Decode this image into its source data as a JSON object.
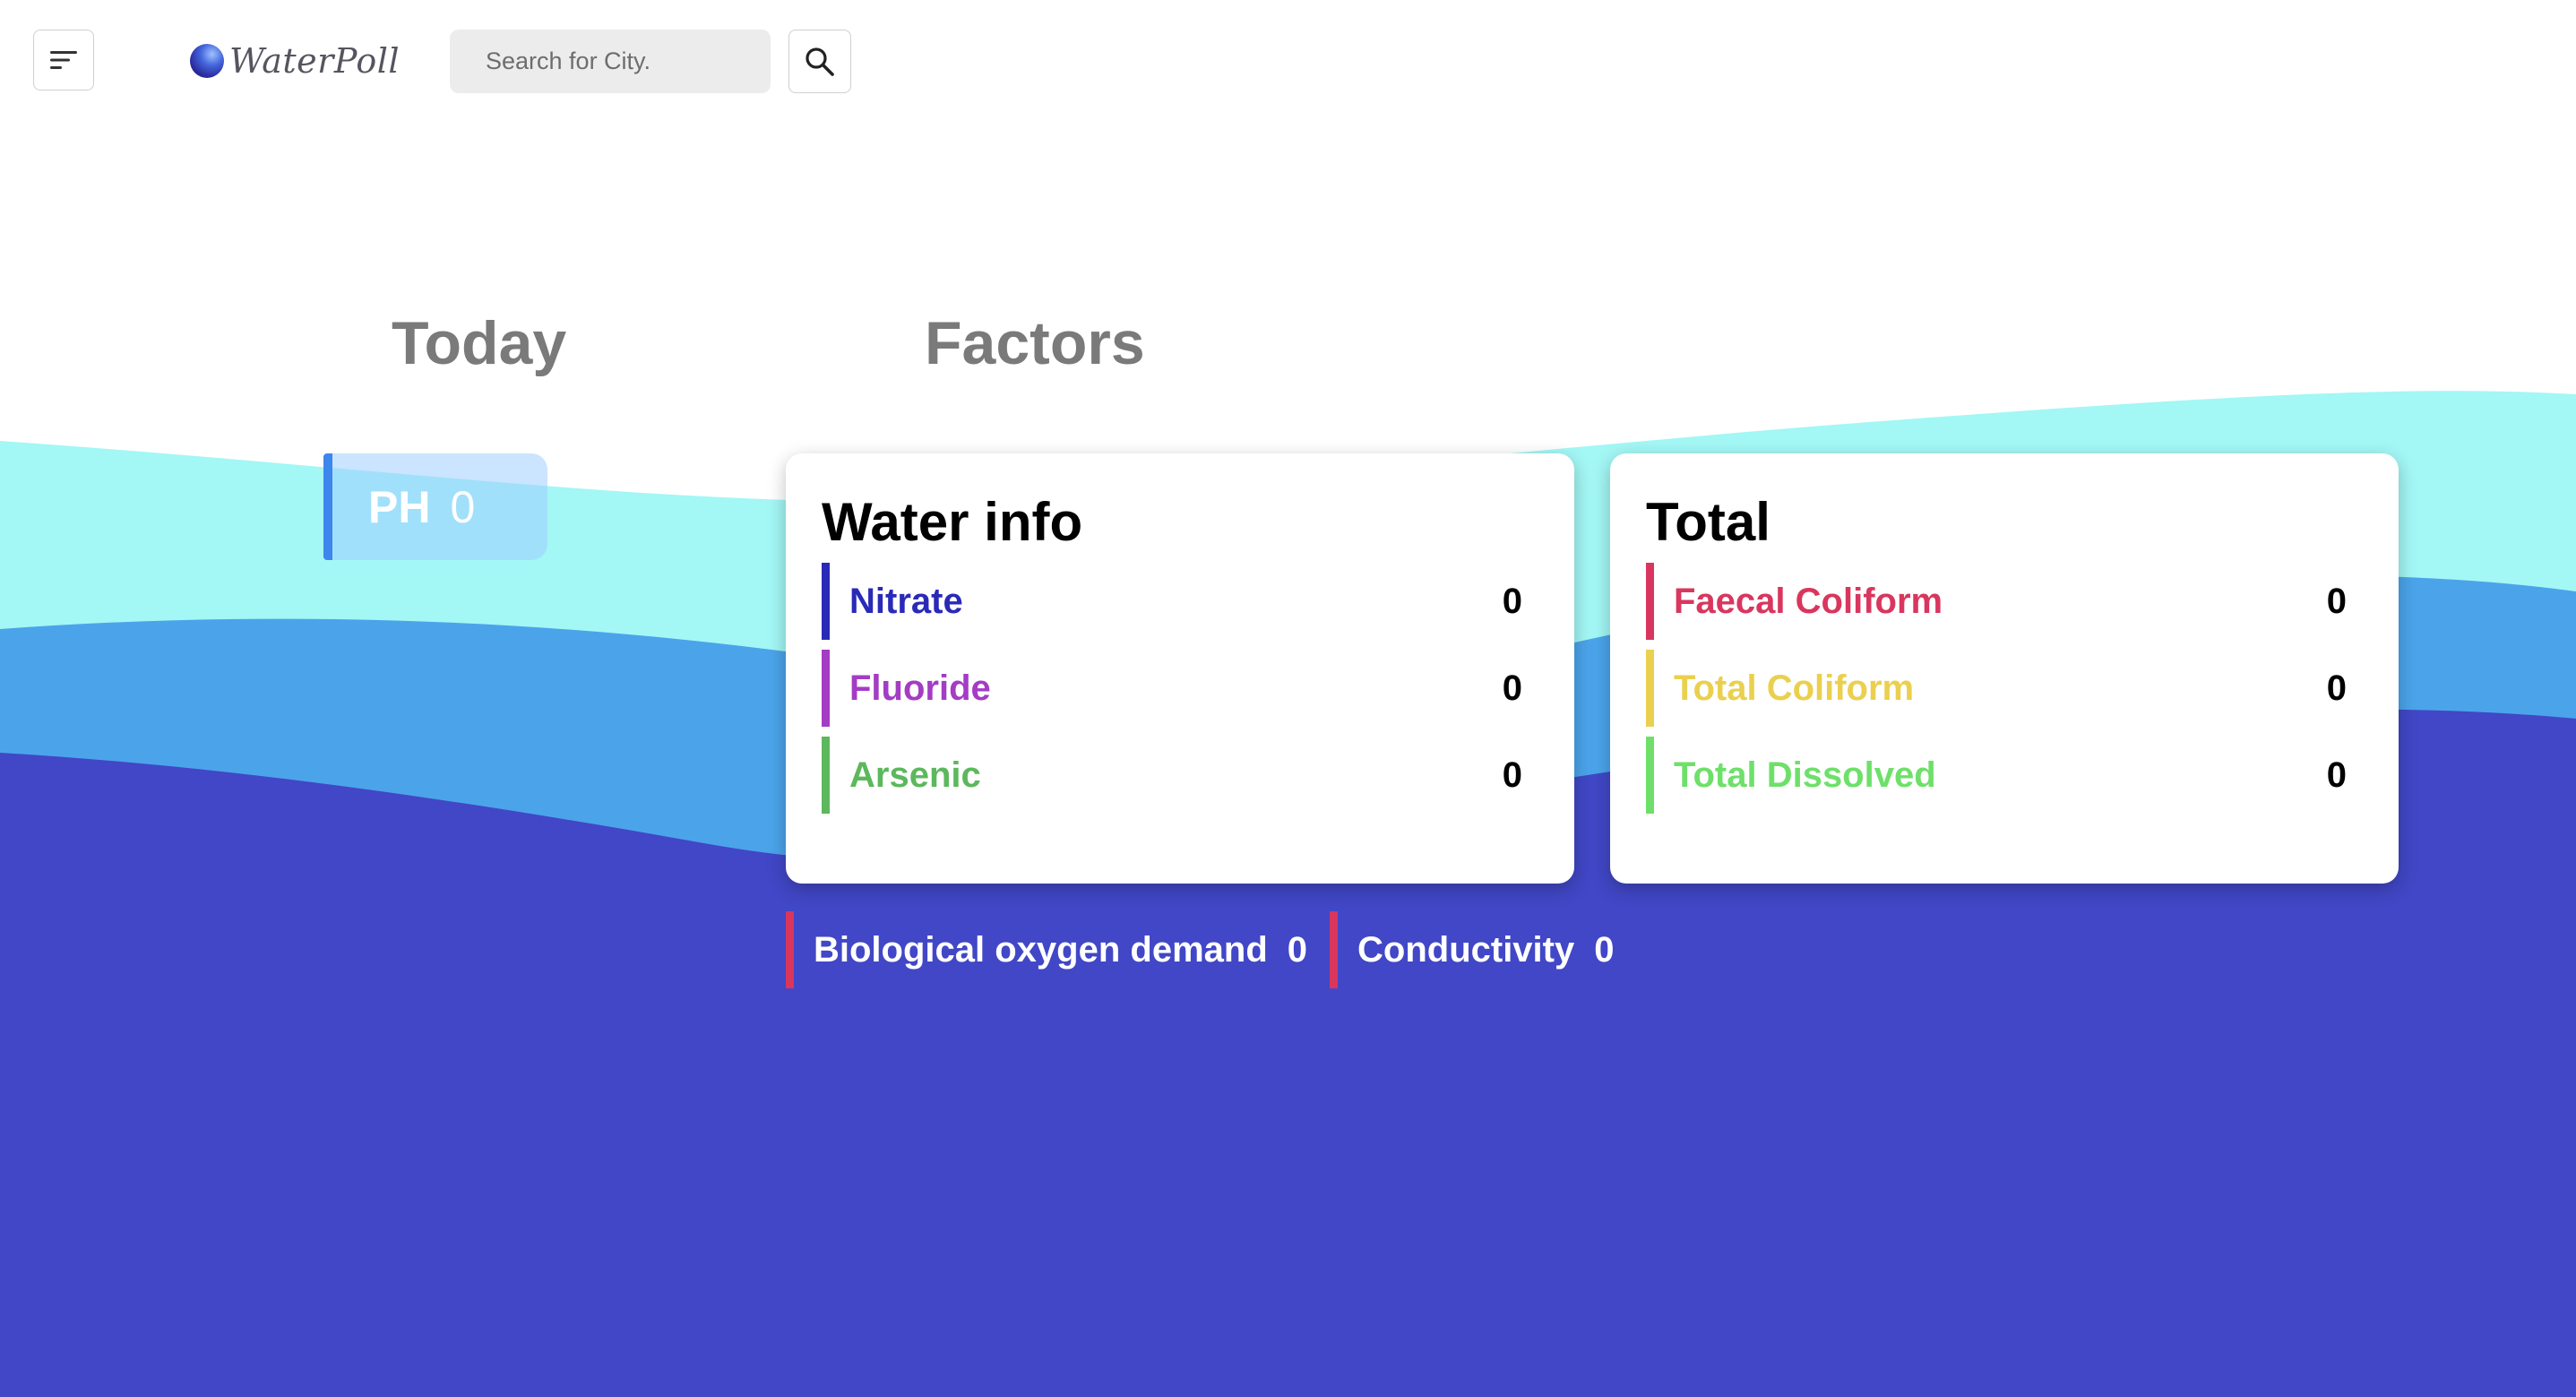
{
  "app": {
    "name": "WaterPoll",
    "logo_icon": "water-globe-icon"
  },
  "header": {
    "menu_icon": "menu-lines-icon",
    "search_placeholder": "Search for City.",
    "search_value": "",
    "search_icon": "magnifier-icon"
  },
  "sections": {
    "today_title": "Today",
    "factors_title": "Factors"
  },
  "ph": {
    "label": "PH",
    "value": "0",
    "accent": "#3c86ee"
  },
  "water_info": {
    "title": "Water info",
    "items": [
      {
        "label": "Nitrate",
        "value": "0",
        "color": "#2a2ab8"
      },
      {
        "label": "Fluoride",
        "value": "0",
        "color": "#a43cc4"
      },
      {
        "label": "Arsenic",
        "value": "0",
        "color": "#5cb85c"
      }
    ]
  },
  "total": {
    "title": "Total",
    "items": [
      {
        "label": "Faecal Coliform",
        "value": "0",
        "color": "#d9365e"
      },
      {
        "label": "Total Coliform",
        "value": "0",
        "color": "#ead04e"
      },
      {
        "label": "Total Dissolved",
        "value": "0",
        "color": "#6ee06a"
      }
    ]
  },
  "extras": [
    {
      "label": "Biological oxygen demand",
      "value": "0",
      "color": "#d9365e"
    },
    {
      "label": "Conductivity",
      "value": "0",
      "color": "#d9365e"
    }
  ],
  "colors": {
    "wave_light": "#a3f7f5",
    "wave_mid": "#4ba4ea",
    "wave_dark": "#4147c6",
    "heading_gray": "#7a7a7a"
  }
}
